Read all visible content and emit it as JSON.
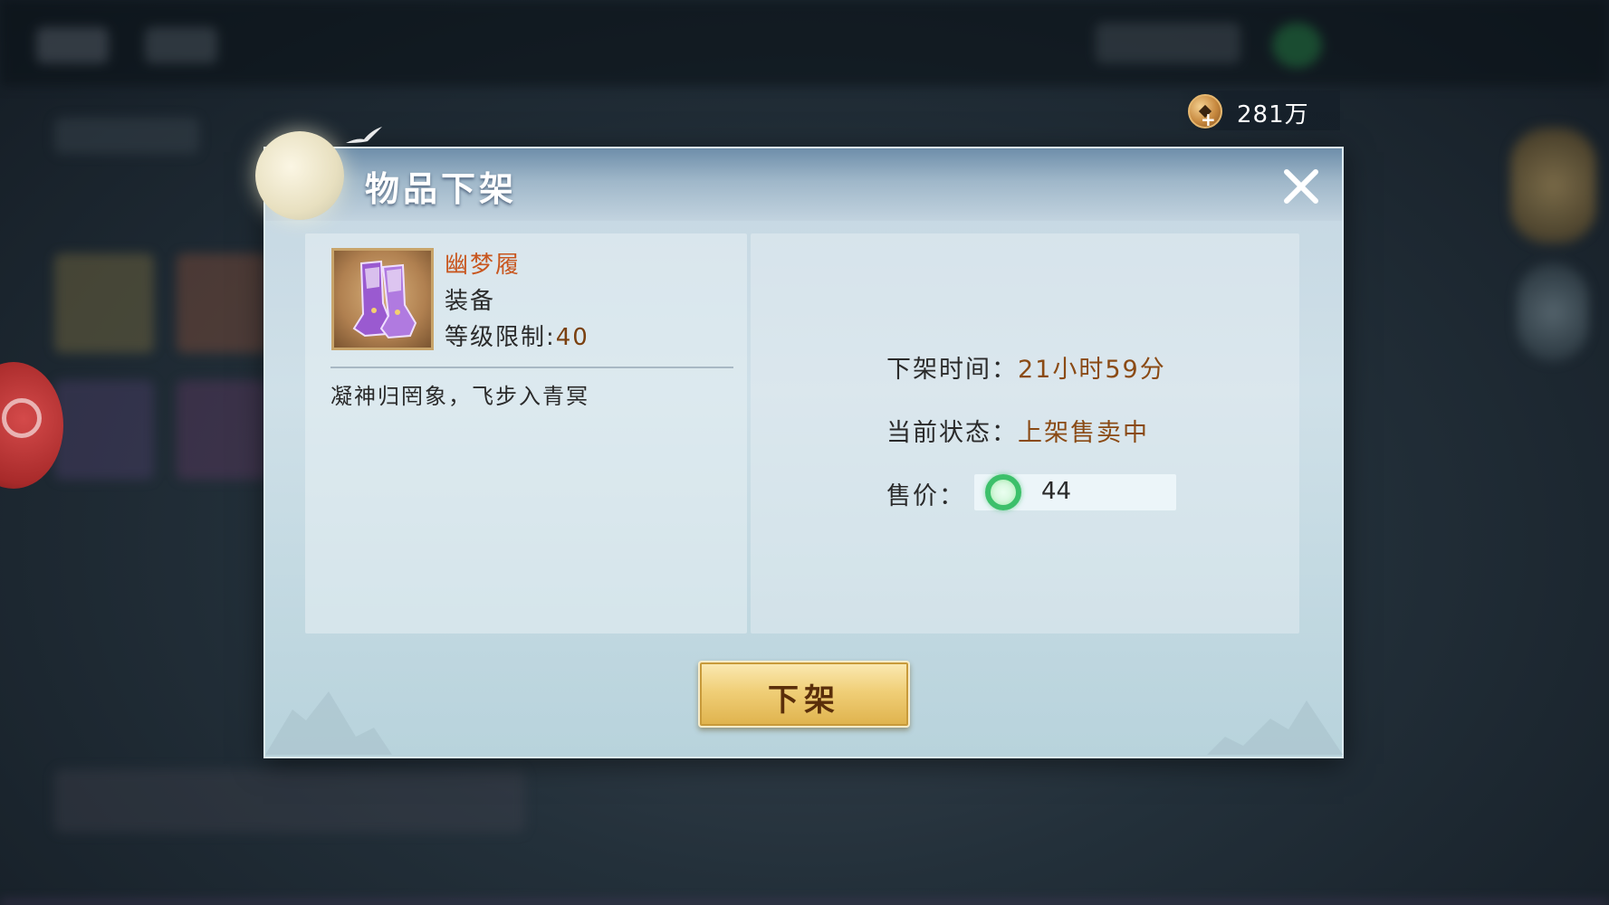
{
  "currency": {
    "icon": "copper-coin-icon",
    "value": "281万"
  },
  "dialog": {
    "title": "物品下架",
    "close_icon": "close-icon",
    "item": {
      "name": "幽梦履",
      "type": "装备",
      "level_label": "等级限制:",
      "level_value": "40",
      "description": "凝神归罔象，飞步入青冥",
      "icon": "purple-boots-icon"
    },
    "info": {
      "time_label": "下架时间：",
      "time_value": "21小时59分",
      "status_label": "当前状态：",
      "status_value": "上架售卖中",
      "price_label": "售价：",
      "price_icon": "jade-ring-icon",
      "price_value": "44"
    },
    "delist_button": "下架"
  },
  "colors": {
    "item_name": "#c8561e",
    "value_text": "#8a4a14",
    "button_gold": "#f0cf78",
    "dialog_bg": "#cfe0e8"
  }
}
